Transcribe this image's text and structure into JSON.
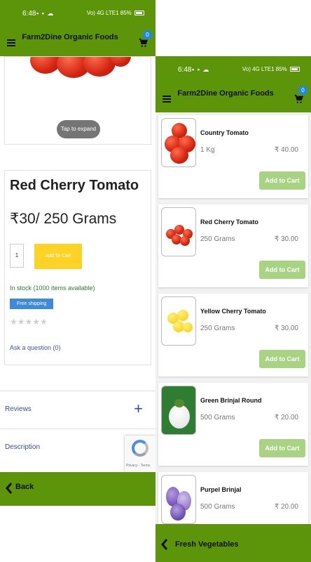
{
  "left": {
    "status": {
      "time": "6:48",
      "signal": "Vo) 4G LTE1",
      "battery": "85%"
    },
    "appbar": {
      "title": "Farm2Dine Organic Foods",
      "cart_count": "0"
    },
    "image": {
      "tap_label": "Tap to expand"
    },
    "product": {
      "name": "Red Cherry Tomato",
      "price": "₹30/ 250 Grams",
      "qty": "1",
      "add_label": "Add To Cart",
      "stock": "In stock (1000 items available)",
      "shipping": "Free shipping",
      "ask": "Ask a question (0)"
    },
    "accordion": [
      {
        "label": "Reviews"
      },
      {
        "label": "Description"
      }
    ],
    "recaptcha": {
      "privacy": "Privacy - Terms"
    },
    "bottombar": {
      "label": "Back"
    }
  },
  "right": {
    "status": {
      "time": "6:48",
      "signal": "Vo) 4G LTE1",
      "battery": "85%"
    },
    "appbar": {
      "title": "Farm2Dine Organic Foods",
      "cart_count": "0"
    },
    "items": [
      {
        "name": "Country Tomato",
        "qty": "1 Kg",
        "price": "₹ 40.00",
        "add_label": "Add to Cart"
      },
      {
        "name": "Red Cherry Tomato",
        "qty": "250 Grams",
        "price": "₹ 30.00",
        "add_label": "Add to Cart"
      },
      {
        "name": "Yellow Cherry Tomato",
        "qty": "250 Grams",
        "price": "₹ 30.00",
        "add_label": "Add to Cart"
      },
      {
        "name": "Green Brinjal Round",
        "qty": "500 Grams",
        "price": "₹ 20.00",
        "add_label": "Add to Cart"
      },
      {
        "name": "Purpel Brinjal",
        "qty": "500 Grams",
        "price": "₹ 20.00",
        "add_label": "Add to Cart"
      }
    ],
    "bottombar": {
      "label": "Fresh Vegetables"
    }
  },
  "colors": {
    "brand_green": "#5c950a",
    "add_yellow": "#ffd326",
    "add_green": "#a8d382",
    "badge_blue": "#1e88e5"
  }
}
